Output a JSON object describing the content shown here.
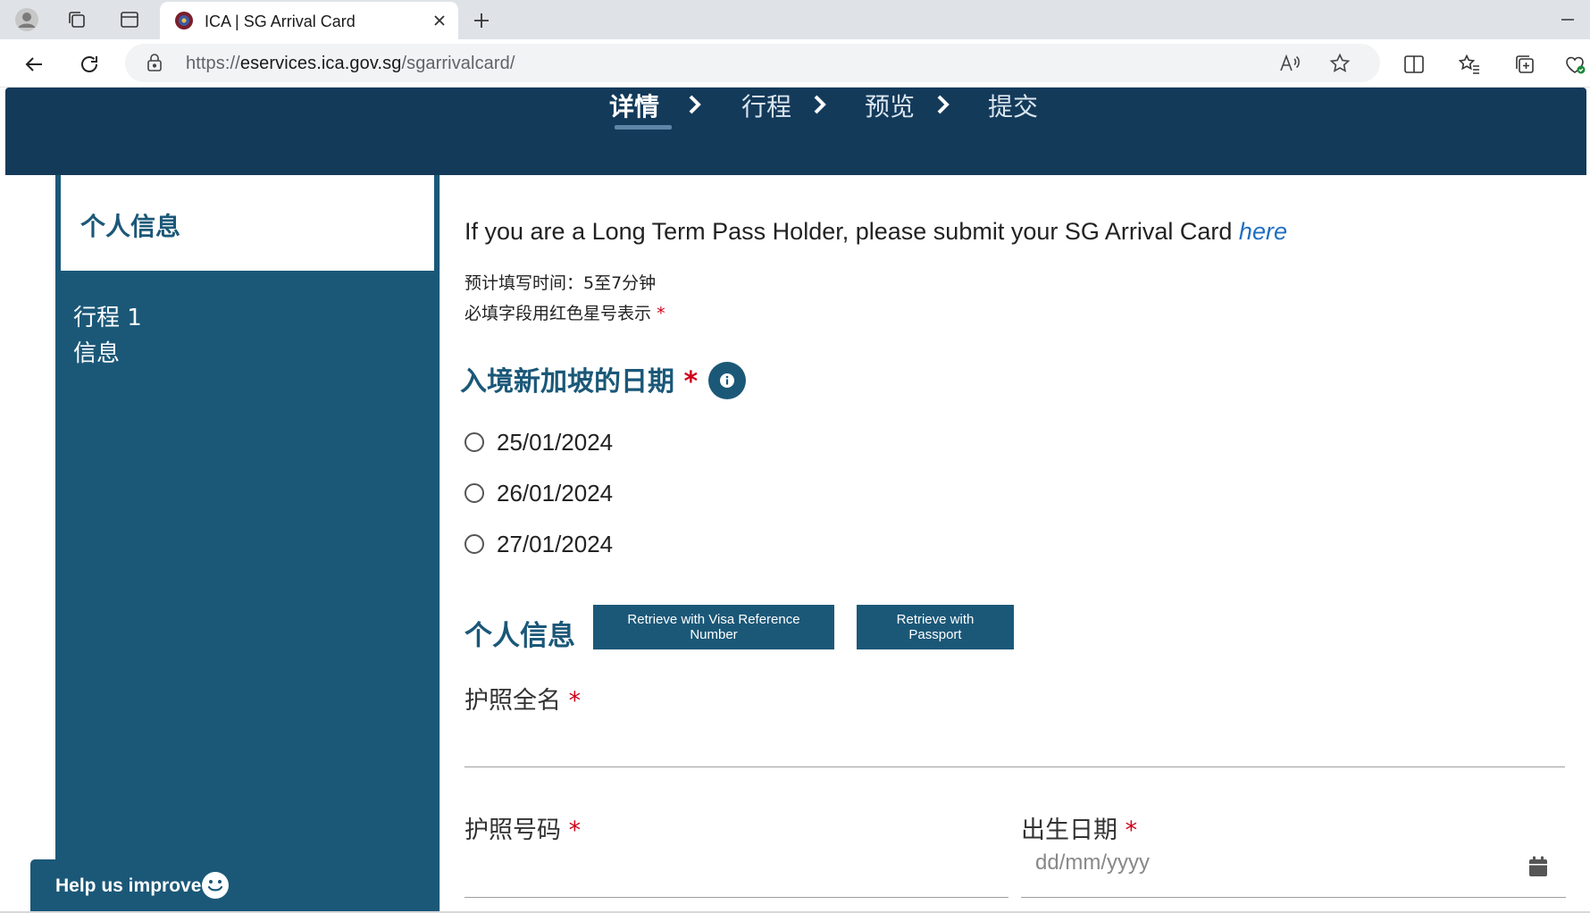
{
  "browser": {
    "tab_title": "ICA | SG Arrival Card",
    "url_scheme": "https://",
    "url_host": "eservices.ica.gov.sg",
    "url_path": "/sgarrivalcard/"
  },
  "steps": [
    {
      "label": "详情",
      "active": true
    },
    {
      "label": "行程",
      "active": false
    },
    {
      "label": "预览",
      "active": false
    },
    {
      "label": "提交",
      "active": false
    }
  ],
  "sidebar": {
    "active_item": "个人信息",
    "items": [
      {
        "label": "行程 1\n信息"
      }
    ]
  },
  "main": {
    "ltph_text": "If you are a Long Term Pass Holder, please submit your SG Arrival Card",
    "ltph_link": "here",
    "est_time": "预计填写时间：5至7分钟",
    "required_note": "必填字段用红色星号表示",
    "required_star": "*",
    "arrival_date": {
      "title": "入境新加坡的日期",
      "options": [
        "25/01/2024",
        "26/01/2024",
        "27/01/2024"
      ]
    },
    "personal": {
      "title": "个人信息",
      "btn_visa": "Retrieve with Visa Reference Number",
      "btn_passport": "Retrieve with Passport"
    },
    "fields": {
      "full_name": "护照全名",
      "passport_no": "护照号码",
      "dob": "出生日期",
      "dob_placeholder": "dd/mm/yyyy"
    }
  },
  "help": {
    "label": "Help us improve"
  },
  "colors": {
    "brand": "#1b5878",
    "header": "#143a5a",
    "required": "#d0021b",
    "link": "#1f6fc2"
  }
}
